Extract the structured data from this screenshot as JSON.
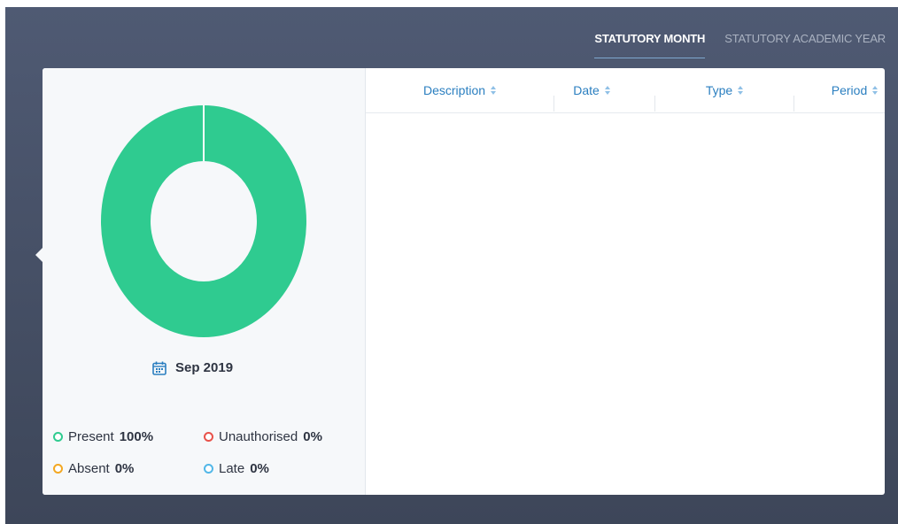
{
  "tabs": {
    "statutory_month": "STATUTORY MONTH",
    "statutory_academic_year": "STATUTORY ACADEMIC YEAR"
  },
  "chart_data": {
    "type": "pie",
    "categories": [
      "Present",
      "Unauthorised",
      "Absent",
      "Late"
    ],
    "values": [
      100,
      0,
      0,
      0
    ],
    "colors": [
      "#2fcb90",
      "#e8524a",
      "#f3a823",
      "#52b7e8"
    ],
    "title": "",
    "donut": true
  },
  "period": {
    "label": "Sep 2019",
    "icon": "calendar-icon"
  },
  "legend": [
    {
      "label": "Present",
      "value": "100%",
      "color": "#2fcb90"
    },
    {
      "label": "Unauthorised",
      "value": "0%",
      "color": "#e8524a"
    },
    {
      "label": "Absent",
      "value": "0%",
      "color": "#f3a823"
    },
    {
      "label": "Late",
      "value": "0%",
      "color": "#52b7e8"
    }
  ],
  "table": {
    "columns": [
      "Description",
      "Date",
      "Type",
      "Period"
    ],
    "sort_icon": "sort-icon",
    "rows": []
  },
  "colors": {
    "accent": "#2b7fc0",
    "background": "#46506a",
    "present": "#2fcb90"
  }
}
